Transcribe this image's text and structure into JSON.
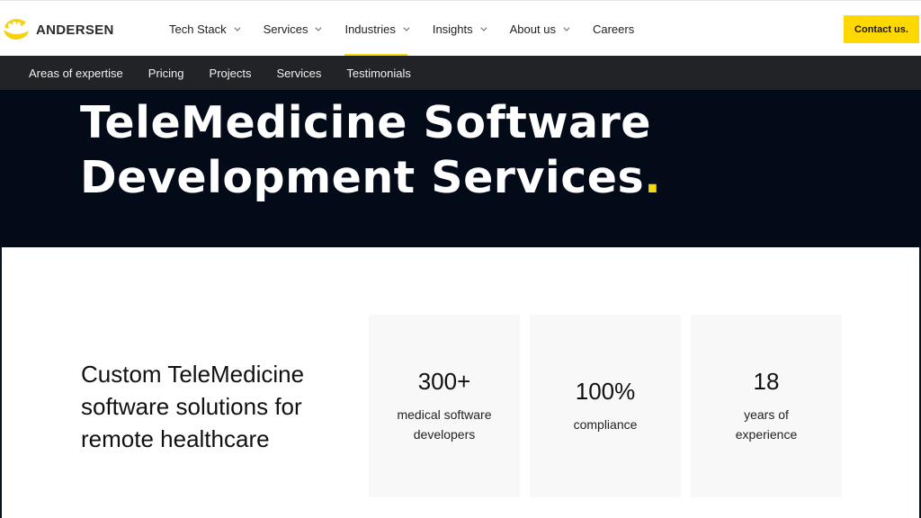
{
  "header": {
    "logo": {
      "icon": "andersen-sun-logo-icon",
      "text": "ANDERSEN"
    },
    "nav": [
      {
        "label": "Tech Stack",
        "has_dropdown": true,
        "active": false
      },
      {
        "label": "Services",
        "has_dropdown": true,
        "active": false
      },
      {
        "label": "Industries",
        "has_dropdown": true,
        "active": true
      },
      {
        "label": "Insights",
        "has_dropdown": true,
        "active": false
      },
      {
        "label": "About us",
        "has_dropdown": true,
        "active": false
      },
      {
        "label": "Careers",
        "has_dropdown": false,
        "active": false
      }
    ],
    "contact_label": "Contact us."
  },
  "subnav": {
    "items": [
      "Areas of expertise",
      "Pricing",
      "Projects",
      "Services",
      "Testimonials"
    ]
  },
  "hero": {
    "title_line1": "TeleMedicine Software",
    "title_line2": "Development Services",
    "title_dot": "."
  },
  "intro": {
    "subtitle": "Custom TeleMedicine software solutions for remote healthcare"
  },
  "stats": [
    {
      "value": "300+",
      "label": "medical software developers"
    },
    {
      "value": "100%",
      "label": "compliance"
    },
    {
      "value": "18",
      "label": "years of experience"
    }
  ],
  "colors": {
    "accent": "#ffd800",
    "hero_bg": "#040b18",
    "subnav_bg": "#222326",
    "card_bg": "#f8f8f8"
  }
}
